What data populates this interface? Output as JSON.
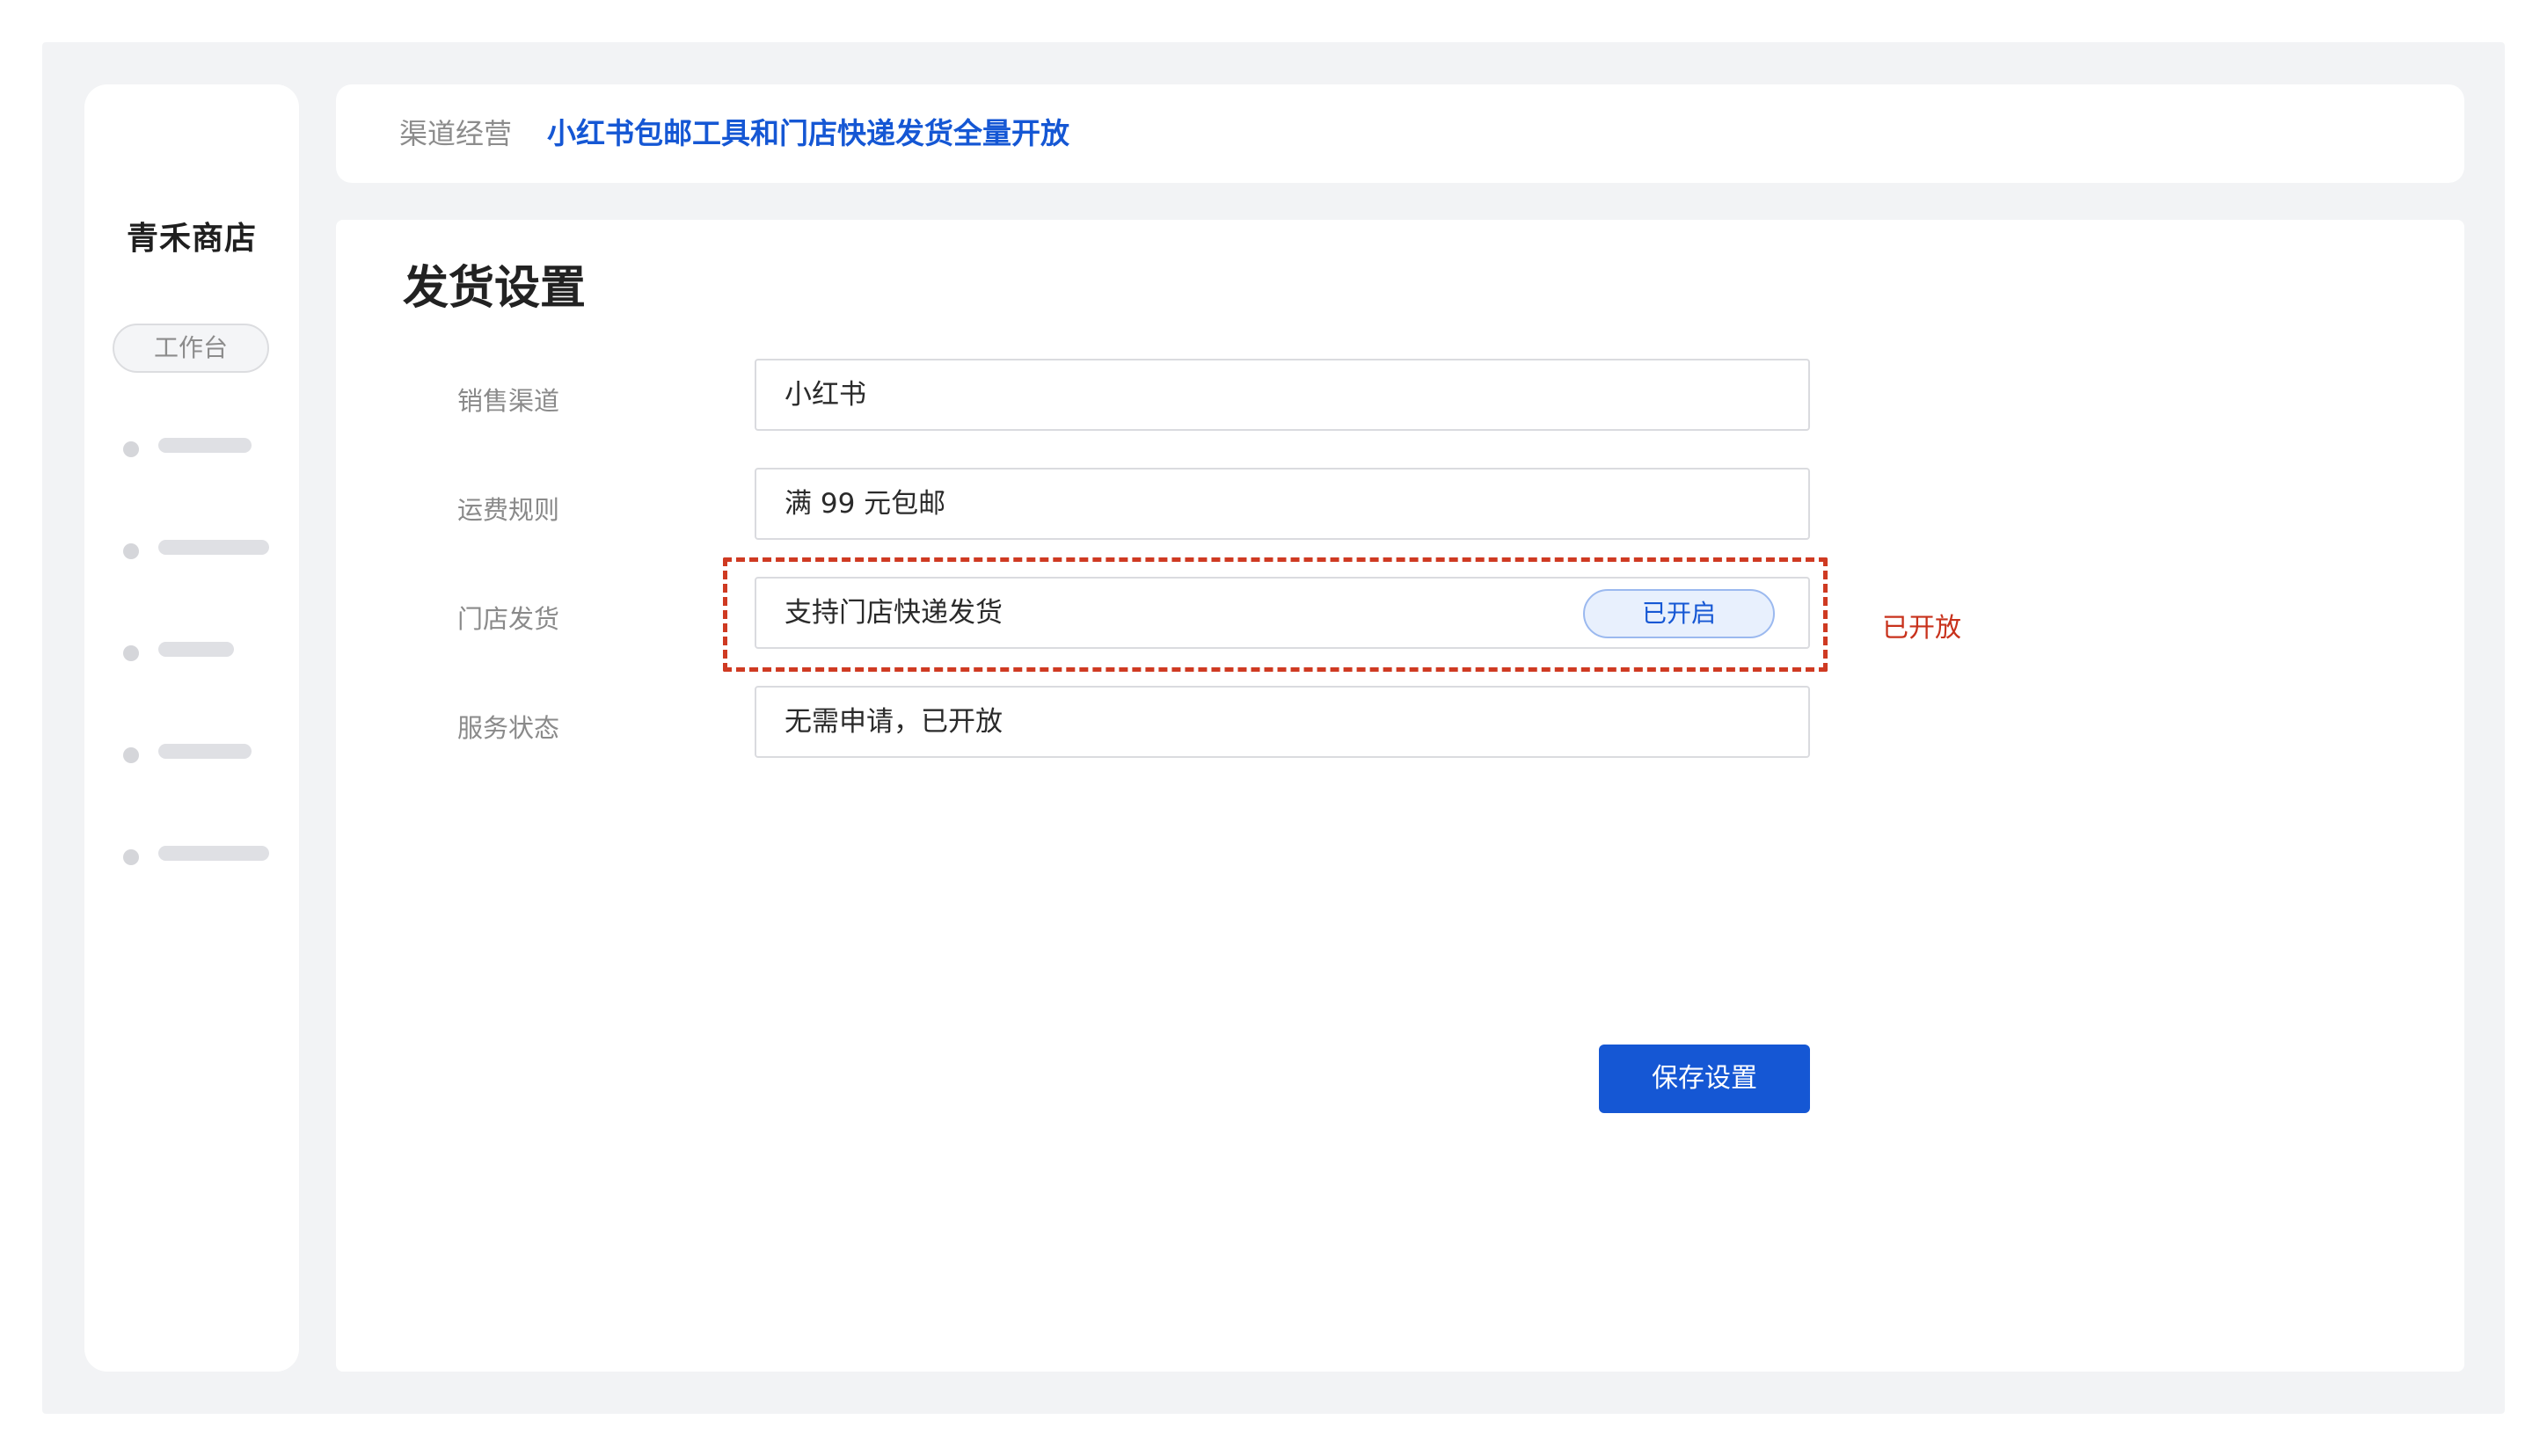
{
  "sidebar": {
    "brand": "青禾商店",
    "workbench_label": "工作台",
    "nav_items": [
      "placeholder-1",
      "placeholder-2",
      "placeholder-3",
      "placeholder-4",
      "placeholder-5"
    ]
  },
  "header": {
    "section": "渠道经营",
    "title": "小红书包邮工具和门店快递发货全量开放"
  },
  "main": {
    "page_title": "发货设置",
    "fields": [
      {
        "label": "销售渠道",
        "value": "小红书"
      },
      {
        "label": "运费规则",
        "value": "满 99 元包邮"
      },
      {
        "label": "门店发货",
        "value": "支持门店快递发货",
        "toggle_label": "已开启"
      },
      {
        "label": "服务状态",
        "value": "无需申请，已开放"
      }
    ],
    "highlight_note": "已开放",
    "save_label": "保存设置"
  },
  "colors": {
    "accent": "#1557d4",
    "highlight": "#cf3a22",
    "background": "#f2f3f5"
  }
}
